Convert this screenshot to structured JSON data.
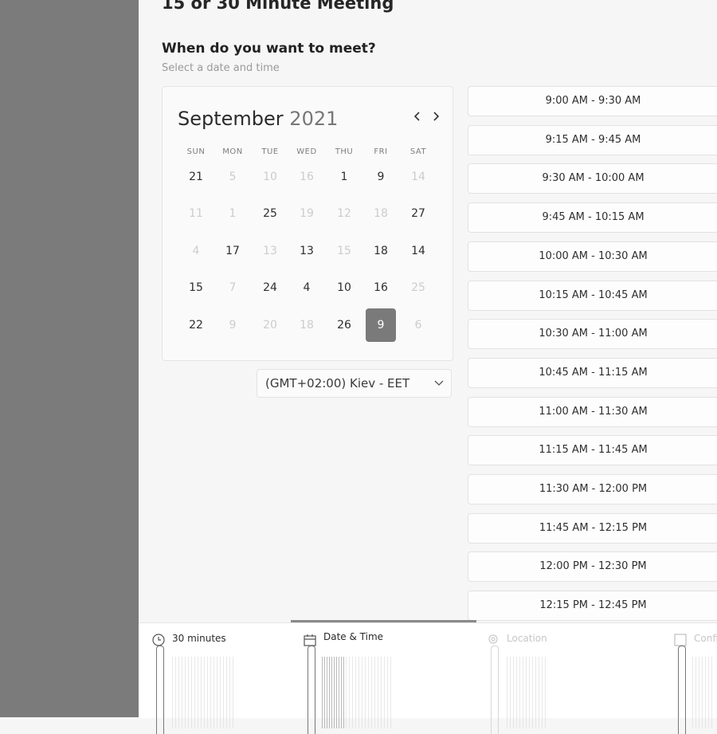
{
  "page": {
    "title": "15 or 30 Minute Meeting"
  },
  "section": {
    "title": "When do you want to meet?",
    "subtitle": "Select a date and time"
  },
  "calendar": {
    "month": "September",
    "year": "2021",
    "weekdays": [
      "SUN",
      "MON",
      "TUE",
      "WED",
      "THU",
      "FRI",
      "SAT"
    ],
    "weeks": [
      [
        {
          "d": "21",
          "on": true
        },
        {
          "d": "5",
          "on": false
        },
        {
          "d": "10",
          "on": false
        },
        {
          "d": "16",
          "on": false
        },
        {
          "d": "1",
          "on": true
        },
        {
          "d": "9",
          "on": true
        },
        {
          "d": "14",
          "on": false
        }
      ],
      [
        {
          "d": "11",
          "on": false
        },
        {
          "d": "1",
          "on": false
        },
        {
          "d": "25",
          "on": true
        },
        {
          "d": "19",
          "on": false
        },
        {
          "d": "12",
          "on": false
        },
        {
          "d": "18",
          "on": false
        },
        {
          "d": "27",
          "on": true
        }
      ],
      [
        {
          "d": "4",
          "on": false
        },
        {
          "d": "17",
          "on": true
        },
        {
          "d": "13",
          "on": false
        },
        {
          "d": "13",
          "on": true
        },
        {
          "d": "15",
          "on": false
        },
        {
          "d": "18",
          "on": true
        },
        {
          "d": "14",
          "on": true
        }
      ],
      [
        {
          "d": "15",
          "on": true
        },
        {
          "d": "7",
          "on": false
        },
        {
          "d": "24",
          "on": true
        },
        {
          "d": "4",
          "on": true
        },
        {
          "d": "10",
          "on": true
        },
        {
          "d": "16",
          "on": true
        },
        {
          "d": "25",
          "on": false
        }
      ],
      [
        {
          "d": "22",
          "on": true
        },
        {
          "d": "9",
          "on": false
        },
        {
          "d": "20",
          "on": false
        },
        {
          "d": "18",
          "on": false
        },
        {
          "d": "26",
          "on": true
        },
        {
          "d": "9",
          "on": true,
          "selected": true
        },
        {
          "d": "6",
          "on": false
        }
      ]
    ]
  },
  "timezone": {
    "label": "(GMT+02:00) Kiev - EET"
  },
  "slots": [
    "9:00 AM - 9:30 AM",
    "9:15 AM - 9:45 AM",
    "9:30 AM - 10:00 AM",
    "9:45 AM - 10:15 AM",
    "10:00 AM - 10:30 AM",
    "10:15 AM - 10:45 AM",
    "10:30 AM - 11:00 AM",
    "10:45 AM - 11:15 AM",
    "11:00 AM - 11:30 AM",
    "11:15 AM - 11:45 AM",
    "11:30 AM - 12:00 PM",
    "11:45 AM - 12:15 PM",
    "12:00 PM - 12:30 PM",
    "12:15 PM - 12:45 PM"
  ],
  "steps": [
    {
      "label": "30 minutes",
      "icon": "clock-icon",
      "active": true
    },
    {
      "label": "Date & Time",
      "icon": "calendar-icon",
      "active": true
    },
    {
      "label": "Location",
      "icon": "location-pin-icon",
      "active": false
    },
    {
      "label": "Confi",
      "icon": "confirm-icon",
      "active": false
    }
  ],
  "colors": {
    "rail": "#7b7b7b",
    "selected_day": "#7a7a7a",
    "background": "#f6f6f6"
  }
}
